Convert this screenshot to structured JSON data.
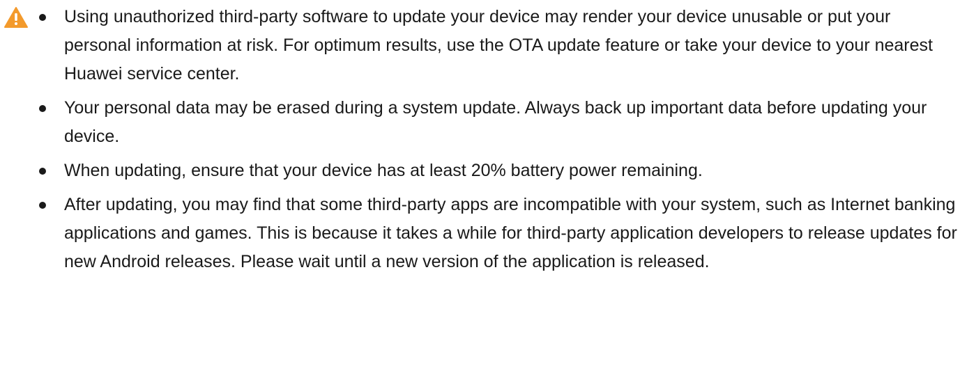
{
  "notice": {
    "icon": "warning-triangle-icon",
    "icon_color": "#f39a2c",
    "items": [
      {
        "text": "Using unauthorized third-party software to update your device may render your device unusable or put your personal information at risk. For optimum results, use the OTA update feature or take your device to your nearest Huawei service center."
      },
      {
        "text": "Your personal data may be erased during a system update. Always back up important data before updating your device."
      },
      {
        "text": "When updating, ensure that your device has at least 20% battery power remaining."
      },
      {
        "text": "After updating, you may find that some third-party apps are incompatible with your system, such as Internet banking applications and games. This is because it takes a while for third-party application developers to release updates for new Android releases. Please wait until a new version of the application is released."
      }
    ]
  }
}
